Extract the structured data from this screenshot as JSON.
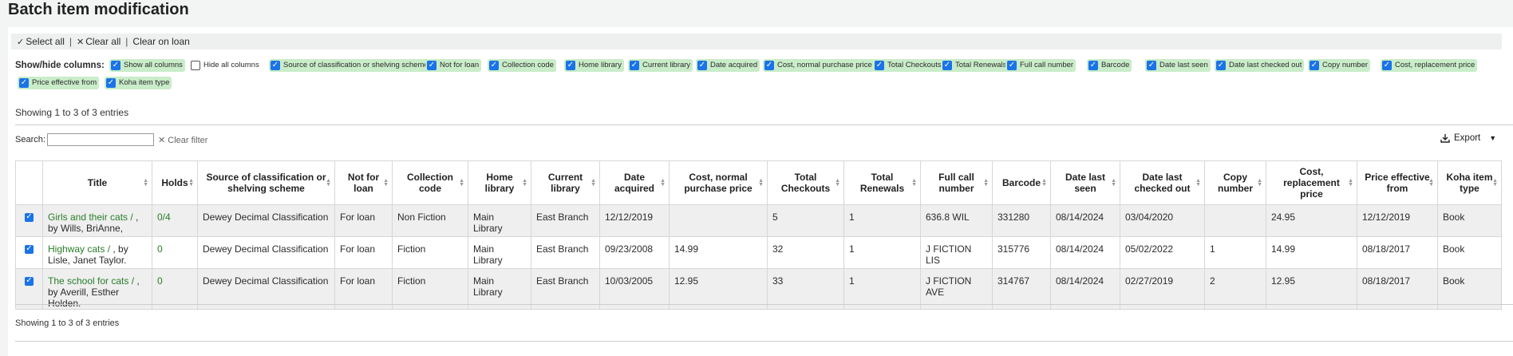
{
  "page_title": "Batch item modification",
  "selectbar": {
    "select_all": "Select all",
    "clear_all": "Clear all",
    "clear_on_loan": "Clear on loan"
  },
  "showhide": {
    "label": "Show/hide columns:",
    "options": [
      {
        "label": "Show all columns",
        "checked": true
      },
      {
        "label": "Hide all columns",
        "checked": false
      },
      {
        "label": "Source of classification or shelving scheme",
        "checked": true
      },
      {
        "label": "Not for loan",
        "checked": true
      },
      {
        "label": "Collection code",
        "checked": true
      },
      {
        "label": "Home library",
        "checked": true
      },
      {
        "label": "Current library",
        "checked": true
      },
      {
        "label": "Date acquired",
        "checked": true
      },
      {
        "label": "Cost, normal purchase price",
        "checked": true
      },
      {
        "label": "Total Checkouts",
        "checked": true
      },
      {
        "label": "Total Renewals",
        "checked": true
      },
      {
        "label": "Full call number",
        "checked": true
      },
      {
        "label": "Barcode",
        "checked": true
      },
      {
        "label": "Date last seen",
        "checked": true
      },
      {
        "label": "Date last checked out",
        "checked": true
      },
      {
        "label": "Copy number",
        "checked": true
      },
      {
        "label": "Cost, replacement price",
        "checked": true
      },
      {
        "label": "Price effective from",
        "checked": true
      },
      {
        "label": "Koha item type",
        "checked": true
      }
    ]
  },
  "showing_top": "Showing 1 to 3 of 3 entries",
  "search": {
    "label": "Search:",
    "value": "",
    "clear_filter": "Clear filter"
  },
  "export": {
    "label": "Export"
  },
  "table": {
    "headers": [
      "",
      "Title",
      "Holds",
      "Source of classification or shelving scheme",
      "Not for loan",
      "Collection code",
      "Home library",
      "Current library",
      "Date acquired",
      "Cost, normal purchase price",
      "Total Checkouts",
      "Total Renewals",
      "Full call number",
      "Barcode",
      "Date last seen",
      "Date last checked out",
      "Copy number",
      "Cost, replacement price",
      "Price effective from",
      "Koha item type"
    ],
    "rows": [
      {
        "checked": true,
        "title_link": "Girls and their cats / ",
        "title_rest": ", by Wills, BriAnne,",
        "holds": "0/4",
        "source": "Dewey Decimal Classification",
        "notforloan": "For loan",
        "ccode": "Non Fiction",
        "home": "Main Library",
        "current": "East Branch",
        "date_acq": "12/12/2019",
        "cost": "",
        "checkouts": "5",
        "renewals": "1",
        "callnum": "636.8 WIL",
        "barcode": "331280",
        "last_seen": "08/14/2024",
        "last_checkout": "03/04/2020",
        "copy": "",
        "replace": "24.95",
        "effective": "12/12/2019",
        "itype": "Book"
      },
      {
        "checked": true,
        "title_link": "Highway cats / ",
        "title_rest": ", by Lisle, Janet Taylor.",
        "holds": "0",
        "source": "Dewey Decimal Classification",
        "notforloan": "For loan",
        "ccode": "Fiction",
        "home": "Main Library",
        "current": "East Branch",
        "date_acq": "09/23/2008",
        "cost": "14.99",
        "checkouts": "32",
        "renewals": "1",
        "callnum": "J FICTION LIS",
        "barcode": "315776",
        "last_seen": "08/14/2024",
        "last_checkout": "05/02/2022",
        "copy": "1",
        "replace": "14.99",
        "effective": "08/18/2017",
        "itype": "Book"
      },
      {
        "checked": true,
        "title_link": "The school for cats / ",
        "title_rest": ", by Averill, Esther Holden.",
        "holds": "0",
        "source": "Dewey Decimal Classification",
        "notforloan": "For loan",
        "ccode": "Fiction",
        "home": "Main Library",
        "current": "East Branch",
        "date_acq": "10/03/2005",
        "cost": "12.95",
        "checkouts": "33",
        "renewals": "1",
        "callnum": "J FICTION AVE",
        "barcode": "314767",
        "last_seen": "08/14/2024",
        "last_checkout": "02/27/2019",
        "copy": "2",
        "replace": "12.95",
        "effective": "08/18/2017",
        "itype": "Book"
      }
    ]
  },
  "showing_bottom": "Showing 1 to 3 of 3 entries"
}
